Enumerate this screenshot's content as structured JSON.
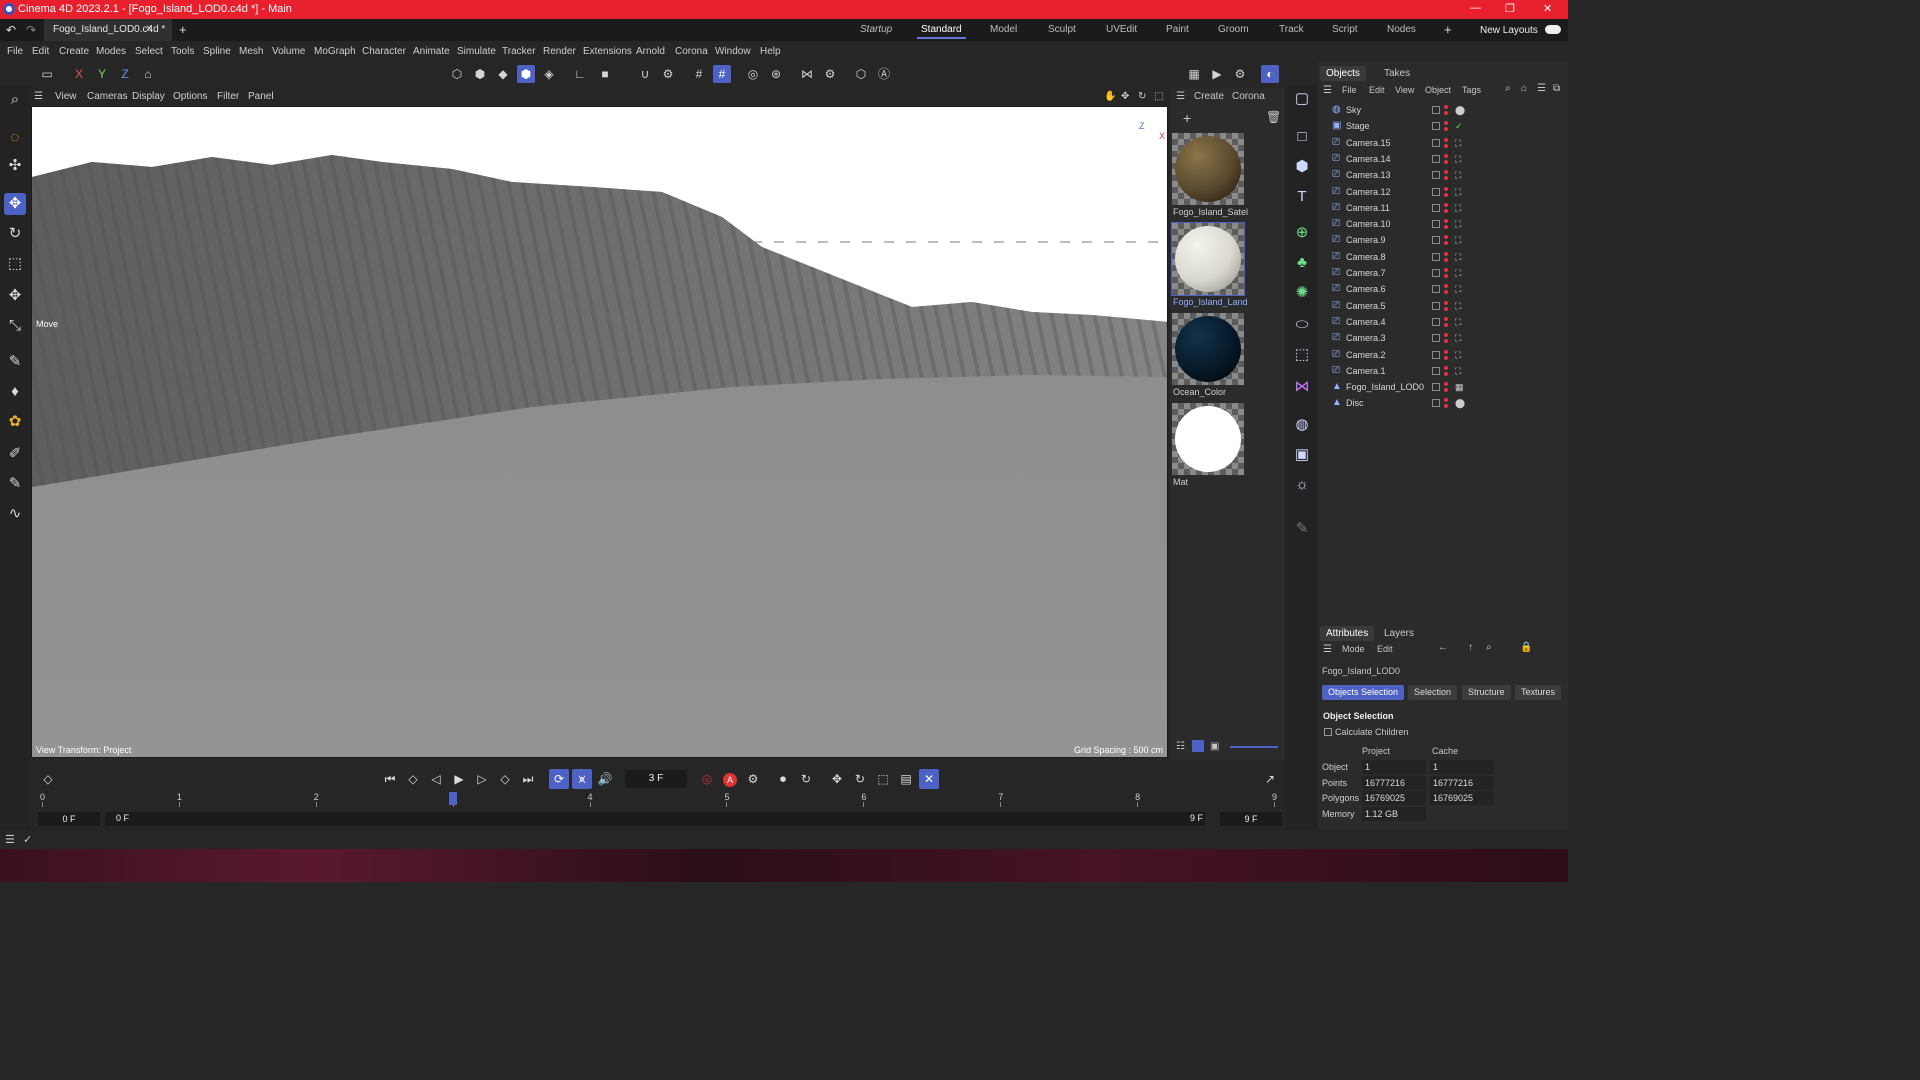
{
  "window": {
    "title": "Cinema 4D 2023.2.1 - [Fogo_Island_LOD0.c4d *] - Main"
  },
  "doc_tab": {
    "label": "Fogo_Island_LOD0.c4d *",
    "close": "×",
    "add": "+"
  },
  "layouts": [
    "Startup",
    "Standard",
    "Model",
    "Sculpt",
    "UVEdit",
    "Paint",
    "Groom",
    "Track",
    "Script",
    "Nodes"
  ],
  "layout_active": "Standard",
  "new_layouts": "New Layouts",
  "menu": [
    "File",
    "Edit",
    "Create",
    "Modes",
    "Select",
    "Tools",
    "Spline",
    "Mesh",
    "Volume",
    "MoGraph",
    "Character",
    "Animate",
    "Simulate",
    "Tracker",
    "Render",
    "Extensions",
    "Arnold",
    "Corona",
    "Window",
    "Help"
  ],
  "axis_buttons": [
    "X",
    "Y",
    "Z"
  ],
  "viewport_menu": [
    "View",
    "Cameras",
    "Display",
    "Options",
    "Filter",
    "Panel"
  ],
  "viewport": {
    "move_label": "Move",
    "view_transform": "View Transform: Project",
    "grid_spacing": "Grid Spacing : 500 cm",
    "axis_z": "Z",
    "axis_x": "X"
  },
  "material_menu": [
    "Create",
    "Corona"
  ],
  "materials": [
    {
      "name": "Fogo_Island_Satel",
      "color": "#5a4a2e"
    },
    {
      "name": "Fogo_Island_Land",
      "color": "#d8d8cf"
    },
    {
      "name": "Ocean_Color",
      "color": "#061a2a"
    },
    {
      "name": "Mat",
      "color": "#ffffff"
    }
  ],
  "object_tabs": [
    "Objects",
    "Takes"
  ],
  "object_menu": [
    "File",
    "Edit",
    "View",
    "Object",
    "Tags"
  ],
  "objects": [
    "Sky",
    "Stage",
    "Camera.15",
    "Camera.14",
    "Camera.13",
    "Camera.12",
    "Camera.11",
    "Camera.10",
    "Camera.9",
    "Camera.8",
    "Camera.7",
    "Camera.6",
    "Camera.5",
    "Camera.4",
    "Camera.3",
    "Camera.2",
    "Camera.1",
    "Fogo_Island_LOD0",
    "Disc"
  ],
  "attr_tabs": [
    "Attributes",
    "Layers"
  ],
  "attr_menu": [
    "Mode",
    "Edit"
  ],
  "attr": {
    "object_name": "Fogo_Island_LOD0",
    "buttons": [
      "Objects Selection",
      "Selection",
      "Structure",
      "Textures"
    ],
    "section": "Object Selection",
    "calc_children": "Calculate Children",
    "col_project": "Project",
    "col_cache": "Cache",
    "rows": [
      {
        "label": "Object",
        "project": "1",
        "cache": "1"
      },
      {
        "label": "Points",
        "project": "16777216",
        "cache": "16777216"
      },
      {
        "label": "Polygons",
        "project": "16769025",
        "cache": "16769025"
      },
      {
        "label": "Memory",
        "project": "1.12 GB",
        "cache": ""
      }
    ]
  },
  "timeline": {
    "current_frame": "3 F",
    "ticks": [
      "0",
      "1",
      "2",
      "3",
      "4",
      "5",
      "6",
      "7",
      "8",
      "9"
    ],
    "start_field": "0 F",
    "start_field2": "0 F",
    "end_field": "9 F",
    "end_field2": "9 F",
    "playhead_frame": 3,
    "total_frames": 9
  },
  "colors": {
    "accent": "#4d62c4",
    "titlebar": "#e8202d"
  }
}
